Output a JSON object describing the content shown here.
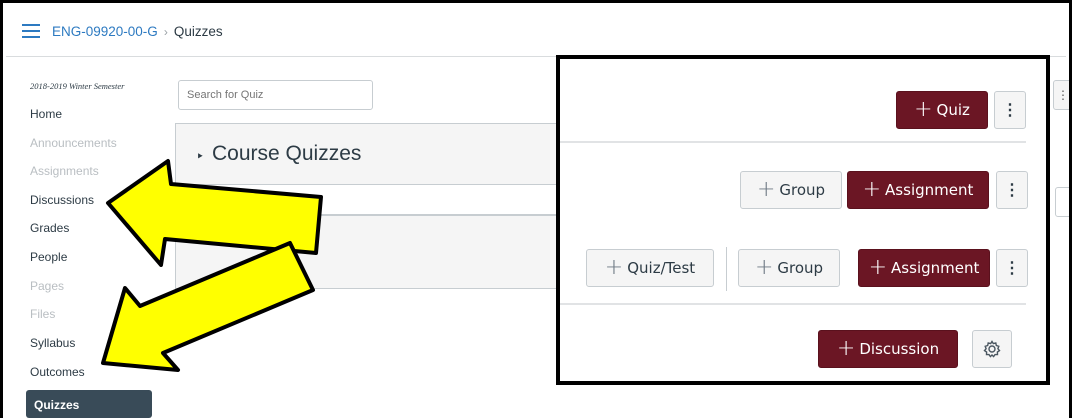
{
  "breadcrumb": {
    "course": "ENG-09920-00-G",
    "page": "Quizzes"
  },
  "sidebar": {
    "term": "2018-2019 Winter Semester",
    "items": [
      {
        "label": "Home",
        "disabled": false
      },
      {
        "label": "Announcements",
        "disabled": true
      },
      {
        "label": "Assignments",
        "disabled": true
      },
      {
        "label": "Discussions",
        "disabled": false
      },
      {
        "label": "Grades",
        "disabled": false
      },
      {
        "label": "People",
        "disabled": false
      },
      {
        "label": "Pages",
        "disabled": true
      },
      {
        "label": "Files",
        "disabled": true
      },
      {
        "label": "Syllabus",
        "disabled": false
      },
      {
        "label": "Outcomes",
        "disabled": false
      }
    ],
    "active": "Quizzes"
  },
  "search": {
    "placeholder": "Search for Quiz"
  },
  "background_kebab": "⋮",
  "quizzes_panel": {
    "toggle": "‣",
    "title": "Course Quizzes"
  },
  "inset": {
    "plus": "+",
    "quiz_label": "Quiz",
    "group_label": "Group",
    "assignment_label": "Assignment",
    "quiztest_label": "Quiz/Test",
    "discussion_label": "Discussion",
    "kebab": "⋮"
  },
  "colors": {
    "primary": "#6b1624",
    "link": "#2d7ac1",
    "active_nav": "#394b58",
    "arrow_fill": "#ffff00"
  },
  "icons": {
    "menu": "hamburger-icon",
    "settings": "gear-icon",
    "more": "kebab-icon"
  }
}
